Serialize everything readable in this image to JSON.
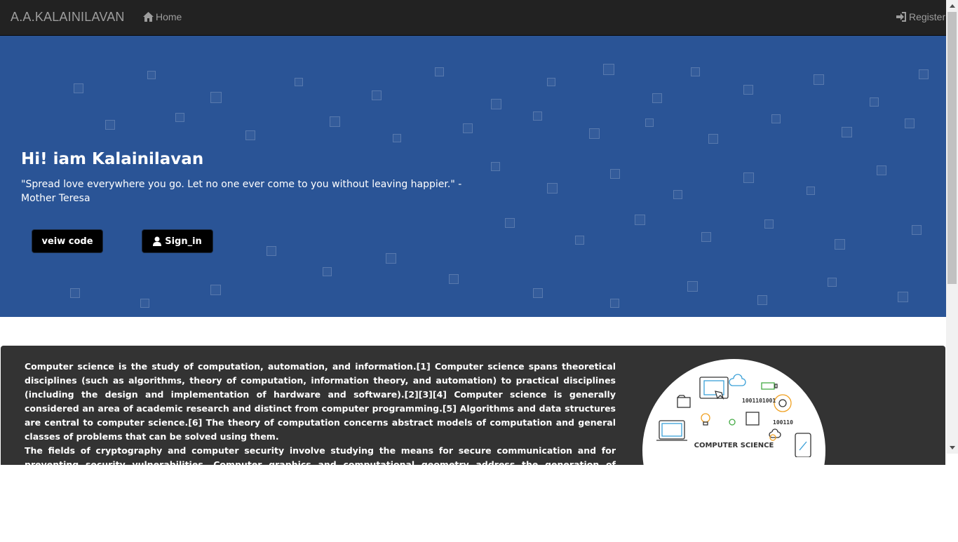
{
  "navbar": {
    "brand": "A.A.KALAINILAVAN",
    "home_label": "Home",
    "home_icon": "home-icon",
    "register_label": "Register",
    "register_icon": "sign-in-icon"
  },
  "hero": {
    "title": "Hi! iam Kalainilavan",
    "quote": "\"Spread love everywhere you go. Let no one ever come to you without leaving happier.\" -Mother Teresa",
    "code_button_label": "veiw code",
    "signin_button_label": "Sign_in",
    "signin_icon": "user-icon",
    "background_color": "#2a5496"
  },
  "about": {
    "paragraph_1": "Computer science is the study of computation, automation, and information.[1] Computer science spans theoretical disciplines (such as algorithms, theory of computation, information theory, and automation) to practical disciplines (including the design and implementation of hardware and software).[2][3][4] Computer science is generally considered an area of academic research and distinct from computer programming.[5] Algorithms and data structures are central to computer science.[6] The theory of computation concerns abstract models of computation and general classes of problems that can be solved using them.",
    "paragraph_2": "The fields of cryptography and computer security involve studying the means for secure communication and for preventing security vulnerabilities. Computer graphics and computational geometry address the generation of images.",
    "image_caption": "COMPUTER SCIENCE",
    "image_binary_1": "1001101001",
    "image_binary_2": "100110",
    "panel_color": "#333333"
  }
}
